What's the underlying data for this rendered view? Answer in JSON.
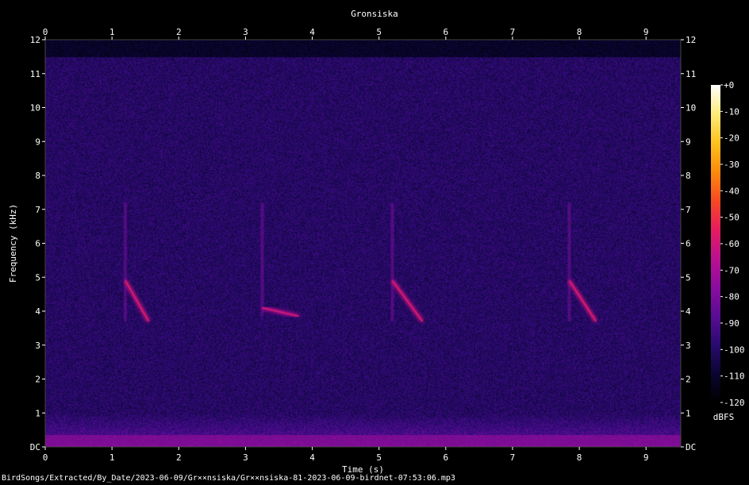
{
  "chart_data": {
    "type": "heatmap",
    "title": "Gronsiska",
    "xlabel": "Time (s)",
    "ylabel": "Frequency (kHz)",
    "xlim": [
      0,
      9.52
    ],
    "ylim": [
      0,
      12
    ],
    "x_ticks": [
      "0",
      "1",
      "2",
      "3",
      "4",
      "5",
      "6",
      "7",
      "8",
      "9"
    ],
    "y_ticks": [
      "DC",
      "1",
      "2",
      "3",
      "4",
      "5",
      "6",
      "7",
      "8",
      "9",
      "10",
      "11",
      "12"
    ],
    "colorbar": {
      "label": "dBFS",
      "range": [
        -120,
        0
      ],
      "ticks": [
        "+0",
        "-10",
        "-20",
        "-30",
        "-40",
        "-50",
        "-60",
        "-70",
        "-80",
        "-90",
        "-100",
        "-110",
        "-120"
      ],
      "colors": [
        "#000000",
        "#0a0530",
        "#2a0a70",
        "#5a0c95",
        "#8c0ca0",
        "#bb108f",
        "#e51d5e",
        "#f64a22",
        "#fb8b0c",
        "#fcc21e",
        "#fdec7a",
        "#ffffff"
      ]
    },
    "background_level_dbfs": -100,
    "calls": [
      {
        "t_start": 1.2,
        "t_end": 1.55,
        "f_high_khz": 4.9,
        "f_low_khz": 3.7,
        "peak_dbfs": -62
      },
      {
        "t_start": 3.25,
        "t_end": 3.8,
        "f_high_khz": 4.1,
        "f_low_khz": 3.85,
        "peak_dbfs": -65
      },
      {
        "t_start": 5.2,
        "t_end": 5.65,
        "f_high_khz": 4.9,
        "f_low_khz": 3.7,
        "peak_dbfs": -62
      },
      {
        "t_start": 7.85,
        "t_end": 8.25,
        "f_high_khz": 4.9,
        "f_low_khz": 3.7,
        "peak_dbfs": -62
      }
    ]
  },
  "footer": {
    "source_path": "BirdSongs/Extracted/By_Date/2023-06-09/Gr××nsiska/Gr××nsiska-81-2023-06-09-birdnet-07:53:06.mp3"
  }
}
